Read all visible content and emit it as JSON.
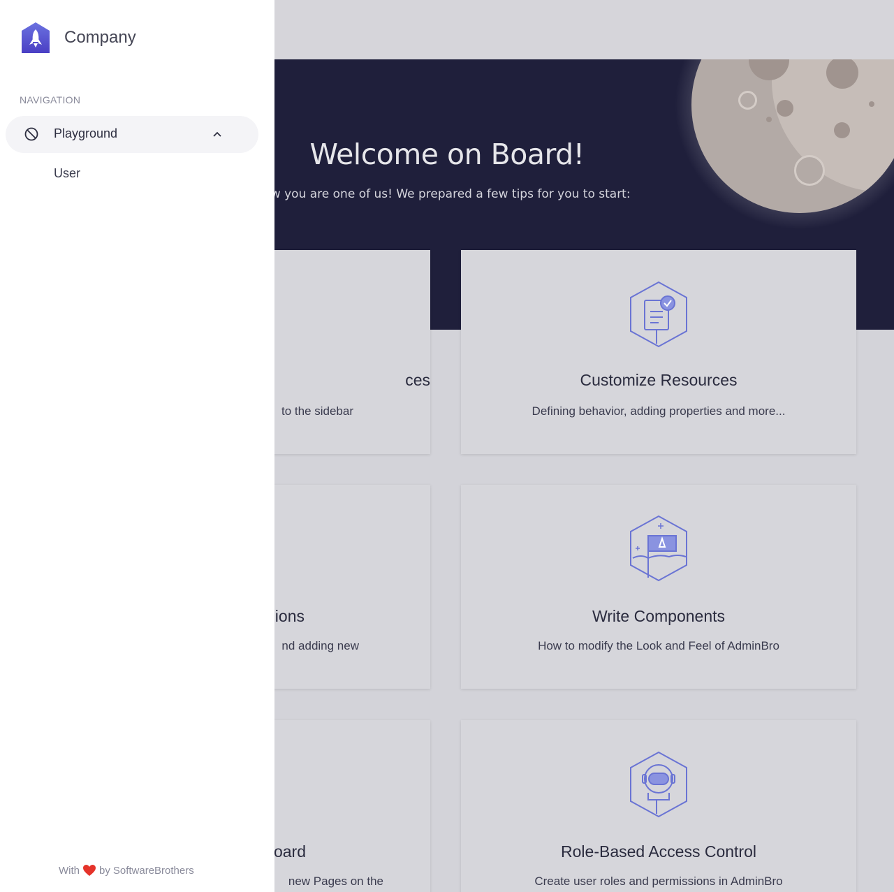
{
  "sidebar": {
    "brand": "Company",
    "navigation_label": "NAVIGATION",
    "items": [
      {
        "label": "Playground",
        "icon": "slash-circle-icon",
        "expanded": true,
        "children": [
          {
            "label": "User"
          }
        ]
      }
    ],
    "footer": {
      "prefix": "With",
      "icon": "heart-icon",
      "suffix": "by",
      "author": "SoftwareBrothers"
    }
  },
  "hero": {
    "title": "Welcome on Board!",
    "subtitle": "ow you are one of us! We prepared a few tips for you to start:"
  },
  "cards": [
    {
      "title": "ces",
      "description": "to the sidebar"
    },
    {
      "title": "Customize Resources",
      "description": "Defining behavior, adding properties and more...",
      "icon": "document-check-icon"
    },
    {
      "title": "ions",
      "description": "nd adding new"
    },
    {
      "title": "Write Components",
      "description": "How to modify the Look and Feel of AdminBro",
      "icon": "flag-rocket-icon"
    },
    {
      "title": "oard",
      "description": "new Pages on the"
    },
    {
      "title": "Role-Based Access Control",
      "description": "Create user roles and permissions in AdminBro",
      "icon": "astronaut-icon"
    }
  ],
  "colors": {
    "hero_bg": "#1f1f3b",
    "accent": "#4d5bd6",
    "heart": "#e5332a"
  }
}
